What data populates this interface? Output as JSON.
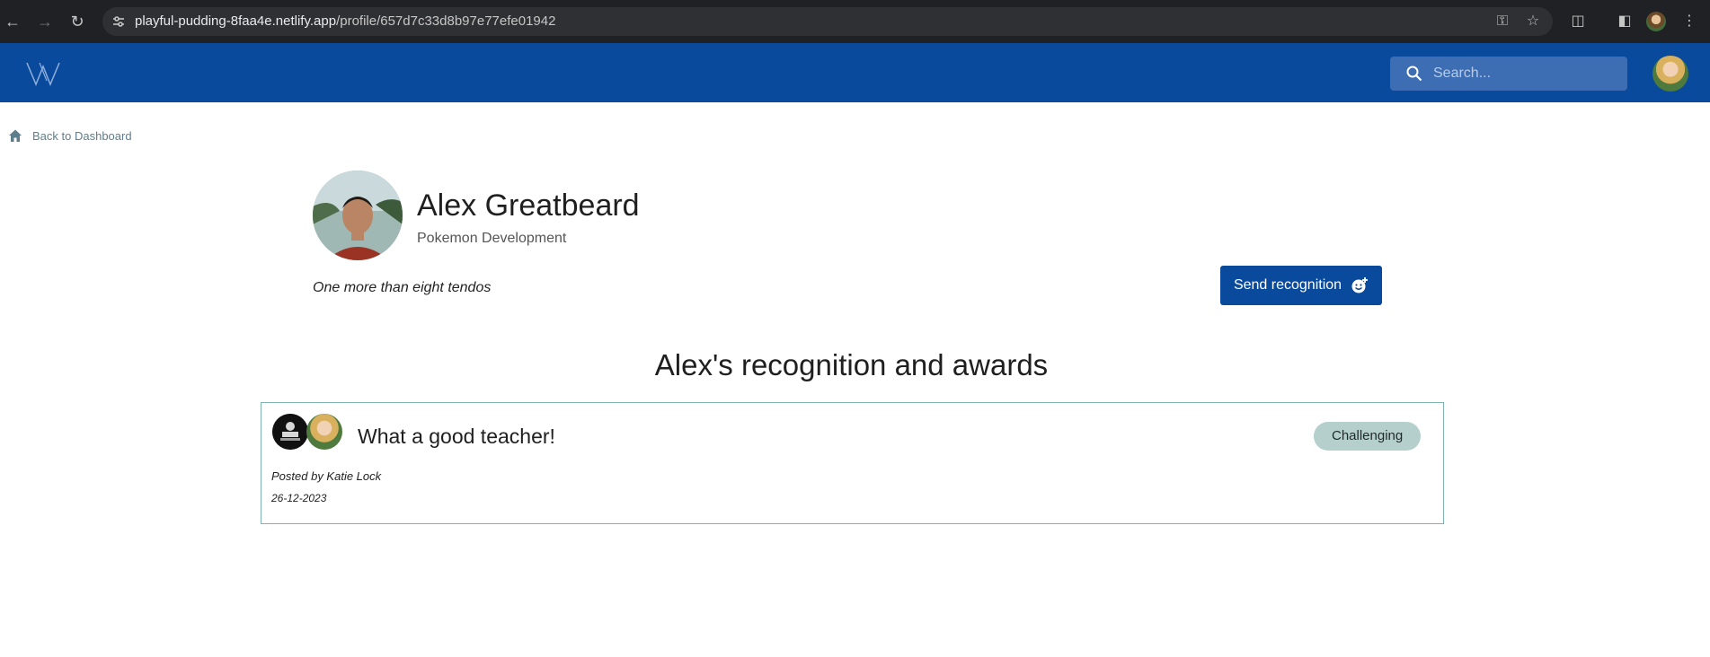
{
  "browser": {
    "url_host": "playful-pudding-8faa4e.netlify.app",
    "url_path": "/profile/657d7c33d8b97e77efe01942",
    "icons": {
      "back": "arrow-left-icon",
      "forward": "arrow-right-icon",
      "reload": "reload-icon",
      "site_info": "tune-icon",
      "password": "key-icon",
      "bookmark": "star-icon",
      "extensions": "puzzle-icon",
      "side_panel": "side-panel-icon",
      "menu": "kebab-menu-icon"
    }
  },
  "header": {
    "background": "#0a4a9c",
    "search": {
      "placeholder": "Search..."
    }
  },
  "back_link": {
    "label": "Back to Dashboard"
  },
  "profile": {
    "name": "Alex Greatbeard",
    "department": "Pokemon Development",
    "bio": "One more than eight tendos",
    "send_button_label": "Send recognition"
  },
  "section": {
    "title": "Alex's recognition and awards"
  },
  "awards": [
    {
      "title": "What a good teacher!",
      "tag": "Challenging",
      "posted_by": "Posted by Katie Lock",
      "date": "26-12-2023"
    }
  ],
  "colors": {
    "accent": "#0a4a9c",
    "card_border": "#7fb3b0",
    "tag_bg": "#b5cfcd"
  }
}
